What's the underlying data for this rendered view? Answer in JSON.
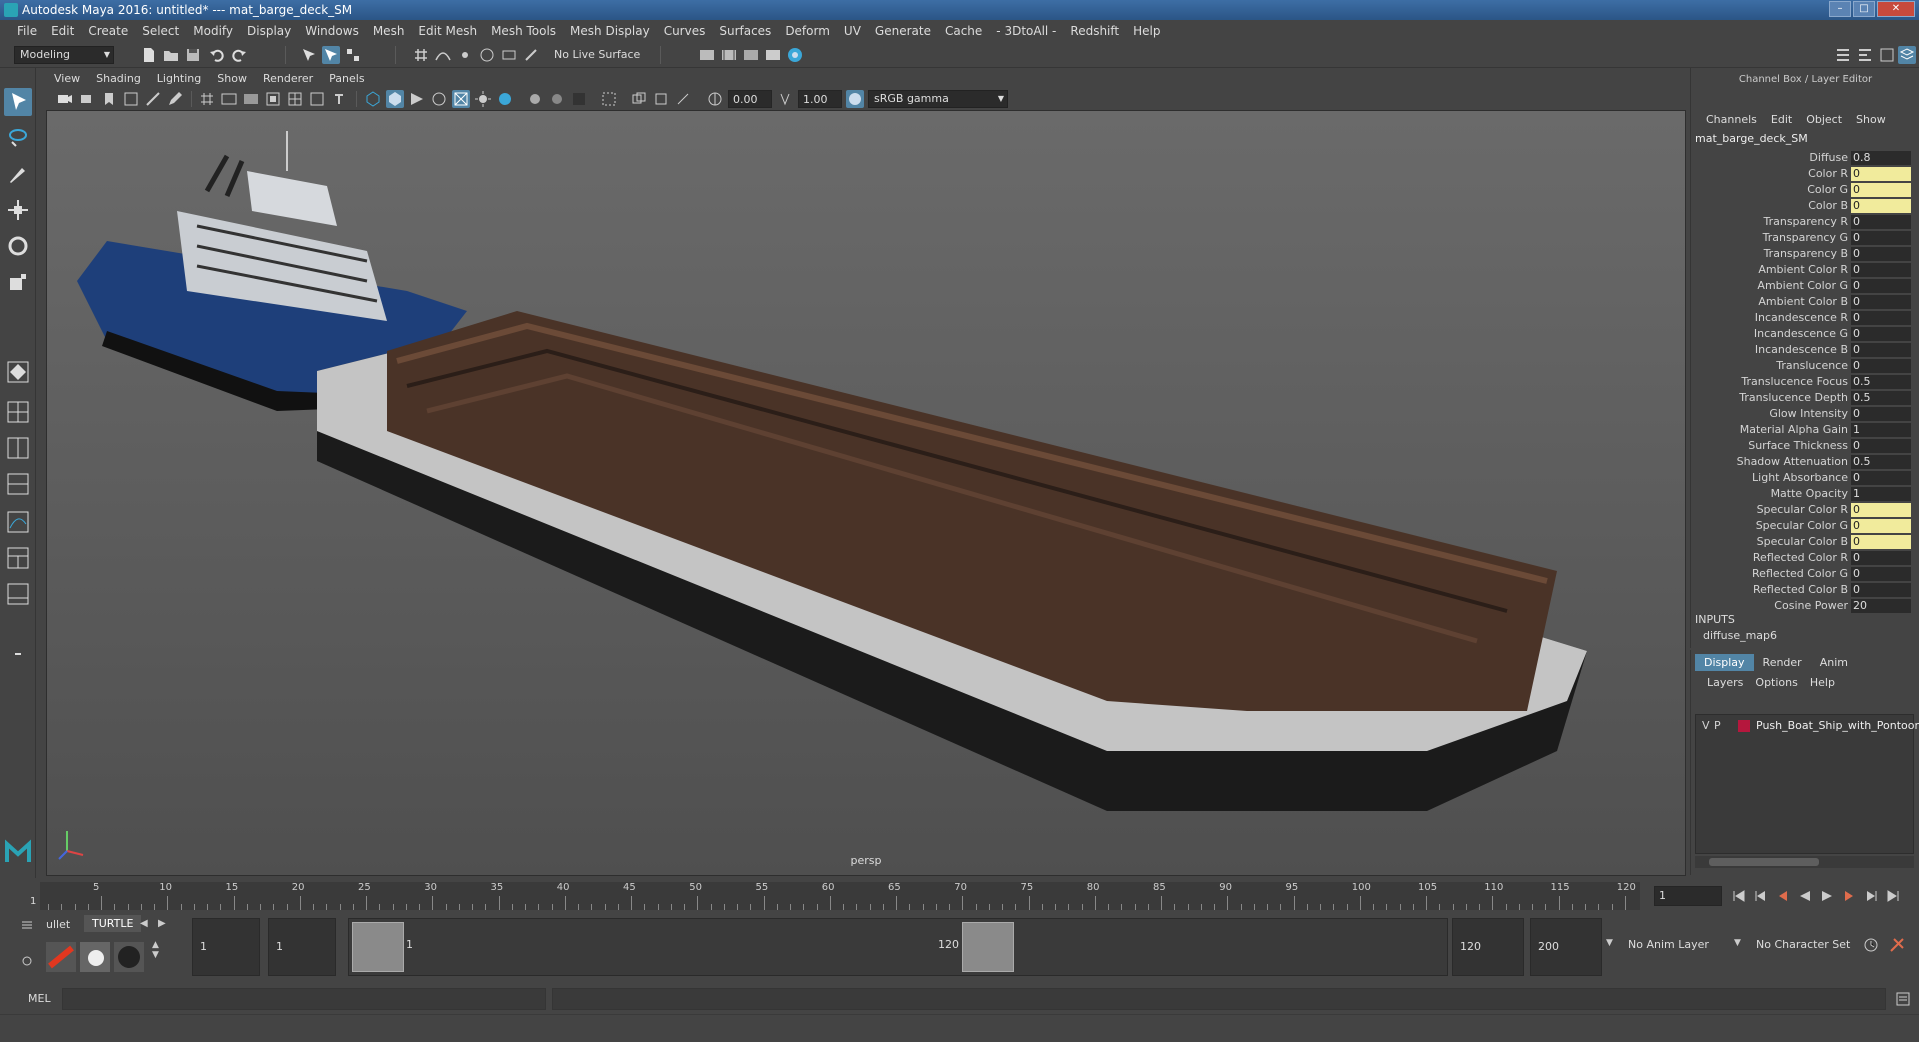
{
  "window": {
    "title": "Autodesk Maya 2016: untitled*   ---   mat_barge_deck_SM",
    "min": "–",
    "max": "□",
    "close": "✕"
  },
  "menubar": [
    "File",
    "Edit",
    "Create",
    "Select",
    "Modify",
    "Display",
    "Windows",
    "Mesh",
    "Edit Mesh",
    "Mesh Tools",
    "Mesh Display",
    "Curves",
    "Surfaces",
    "Deform",
    "UV",
    "Generate",
    "Cache",
    "- 3DtoAll -",
    "Redshift",
    "Help"
  ],
  "statusline": {
    "menuset": "Modeling",
    "live_surface": "No Live Surface"
  },
  "panel": {
    "menus": [
      "View",
      "Shading",
      "Lighting",
      "Show",
      "Renderer",
      "Panels"
    ],
    "near_value": "0.00",
    "far_value": "1.00",
    "colorspace": "sRGB gamma",
    "camera": "persp"
  },
  "channelbox": {
    "title": "Channel Box / Layer Editor",
    "menus": [
      "Channels",
      "Edit",
      "Object",
      "Show"
    ],
    "node": "mat_barge_deck_SM",
    "attributes": [
      {
        "label": "Diffuse",
        "value": "0.8",
        "hl": false
      },
      {
        "label": "Color R",
        "value": "0",
        "hl": true
      },
      {
        "label": "Color G",
        "value": "0",
        "hl": true
      },
      {
        "label": "Color B",
        "value": "0",
        "hl": true
      },
      {
        "label": "Transparency R",
        "value": "0",
        "hl": false
      },
      {
        "label": "Transparency G",
        "value": "0",
        "hl": false
      },
      {
        "label": "Transparency B",
        "value": "0",
        "hl": false
      },
      {
        "label": "Ambient Color R",
        "value": "0",
        "hl": false
      },
      {
        "label": "Ambient Color G",
        "value": "0",
        "hl": false
      },
      {
        "label": "Ambient Color B",
        "value": "0",
        "hl": false
      },
      {
        "label": "Incandescence R",
        "value": "0",
        "hl": false
      },
      {
        "label": "Incandescence G",
        "value": "0",
        "hl": false
      },
      {
        "label": "Incandescence B",
        "value": "0",
        "hl": false
      },
      {
        "label": "Translucence",
        "value": "0",
        "hl": false
      },
      {
        "label": "Translucence Focus",
        "value": "0.5",
        "hl": false
      },
      {
        "label": "Translucence Depth",
        "value": "0.5",
        "hl": false
      },
      {
        "label": "Glow Intensity",
        "value": "0",
        "hl": false
      },
      {
        "label": "Material Alpha Gain",
        "value": "1",
        "hl": false
      },
      {
        "label": "Surface Thickness",
        "value": "0",
        "hl": false
      },
      {
        "label": "Shadow Attenuation",
        "value": "0.5",
        "hl": false
      },
      {
        "label": "Light Absorbance",
        "value": "0",
        "hl": false
      },
      {
        "label": "Matte Opacity",
        "value": "1",
        "hl": false
      },
      {
        "label": "Specular Color R",
        "value": "0",
        "hl": true
      },
      {
        "label": "Specular Color G",
        "value": "0",
        "hl": true
      },
      {
        "label": "Specular Color B",
        "value": "0",
        "hl": true
      },
      {
        "label": "Reflected Color R",
        "value": "0",
        "hl": false
      },
      {
        "label": "Reflected Color G",
        "value": "0",
        "hl": false
      },
      {
        "label": "Reflected Color B",
        "value": "0",
        "hl": false
      },
      {
        "label": "Cosine Power",
        "value": "20",
        "hl": false
      }
    ],
    "inputs_header": "INPUTS",
    "input_item": "diffuse_map6"
  },
  "layereditor": {
    "tabs": [
      "Display",
      "Render",
      "Anim"
    ],
    "menus": [
      "Layers",
      "Options",
      "Help"
    ],
    "layer": {
      "v": "V",
      "p": "P",
      "name": "Push_Boat_Ship_with_Pontoon",
      "color": "#b5173d"
    }
  },
  "timeslider": {
    "ticks": [
      "5",
      "10",
      "15",
      "20",
      "25",
      "30",
      "35",
      "40",
      "45",
      "50",
      "55",
      "60",
      "65",
      "70",
      "75",
      "80",
      "85",
      "90",
      "95",
      "100",
      "105",
      "110",
      "115",
      "120"
    ],
    "current_frame_marker": "1",
    "current_frame": "1"
  },
  "rangeslider": {
    "shelf_tabs": [
      "ullet",
      "TURTLE"
    ],
    "start": "1",
    "playback_start": "1",
    "range_start": "1",
    "range_end": "120",
    "playback_end": "120",
    "end": "200",
    "anim_layer": "No Anim Layer",
    "character_set": "No Character Set"
  },
  "cmdline": {
    "label": "MEL"
  }
}
